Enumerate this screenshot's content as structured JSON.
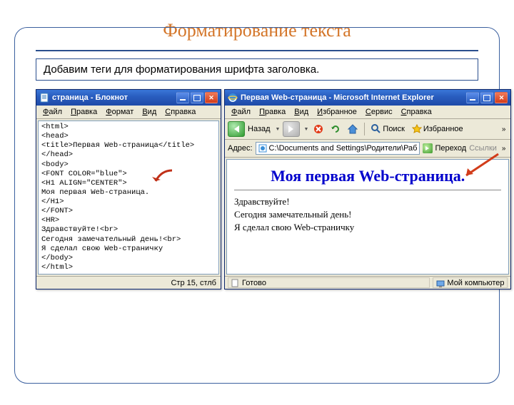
{
  "slide": {
    "title": "Форматирование текста",
    "subtitle": "Добавим теги для форматирования шрифта заголовка."
  },
  "notepad": {
    "title": "страница - Блокнот",
    "menu": {
      "file": "Файл",
      "edit": "Правка",
      "format": "Формат",
      "view": "Вид",
      "help": "Справка"
    },
    "code": "<html>\n<head>\n<title>Первая Web-страница</title>\n</head>\n<body>\n<FONT COLOR=\"blue\">\n<H1 ALIGN=\"CENTER\">\nМоя первая Web-страница.\n</H1>\n</FONT>\n<HR>\nЗдравствуйте!<br>\nСегодня замечательный день!<br>\nЯ сделал свою Web-страничку\n</body>\n</html>",
    "status": "Стр 15, стлб"
  },
  "ie": {
    "title": "Первая Web-страница - Microsoft Internet Explorer",
    "menu": {
      "file": "Файл",
      "edit": "Правка",
      "view": "Вид",
      "favorites": "Избранное",
      "tools": "Сервис",
      "help": "Справка"
    },
    "toolbar": {
      "back_label": "Назад",
      "search_label": "Поиск",
      "favorites_label": "Избранное"
    },
    "address": {
      "label": "Адрес:",
      "value": "C:\\Documents and Settings\\Родители\\Раб",
      "go": "Переход",
      "links": "Ссылки"
    },
    "page": {
      "heading": "Моя первая Web-страница.",
      "line1": "Здравствуйте!",
      "line2": "Сегодня замечательный день!",
      "line3": "Я сделал свою Web-страничку"
    },
    "status": {
      "ready": "Готово",
      "zone": "Мой компьютер"
    }
  }
}
